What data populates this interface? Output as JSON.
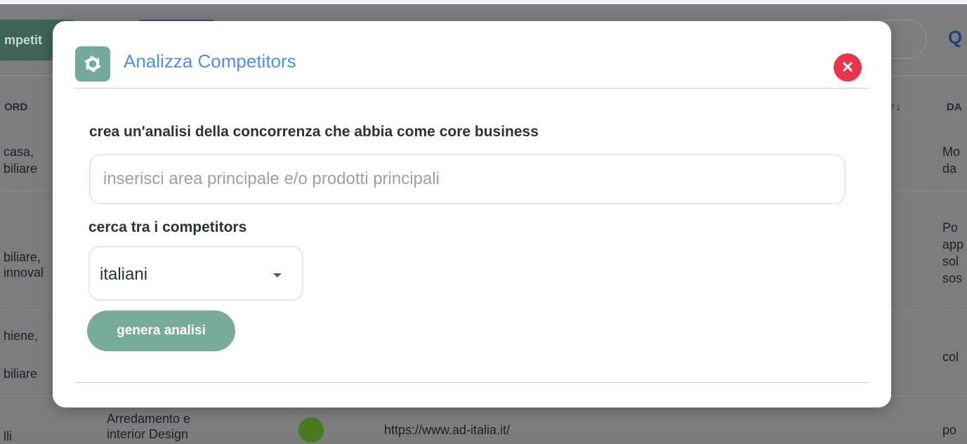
{
  "background": {
    "tab_label": "mpetit",
    "header_left": "ORD",
    "header_sort": "↑↓",
    "header_right": "DA",
    "col_left": [
      "casa,",
      "biliare",
      "biliare,",
      "innoval",
      "hiene,",
      "biliare",
      "lli"
    ],
    "col_right": [
      "Mo",
      "da",
      "Po",
      "app",
      "sol",
      "sos",
      "col",
      "po"
    ],
    "row_category": "Arredamento e\ninterior Design",
    "row_url": "https://www.ad-italia.it/"
  },
  "modal": {
    "title": "Analizza Competitors",
    "close_icon": "close-icon",
    "logo_icon": "openai-logo-icon",
    "business_label": "crea un'analisi della concorrenza che abbia come core business",
    "business_placeholder": "inserisci area principale e/o prodotti principali",
    "business_value": "",
    "competitors_label": "cerca tra i competitors",
    "competitors_selected": "italiani",
    "generate_label": "genera analisi"
  },
  "colors": {
    "accent_title": "#4f8fe8",
    "close": "#e8334a",
    "button": "#78ab9c",
    "logo_bg": "#74aa9c"
  }
}
